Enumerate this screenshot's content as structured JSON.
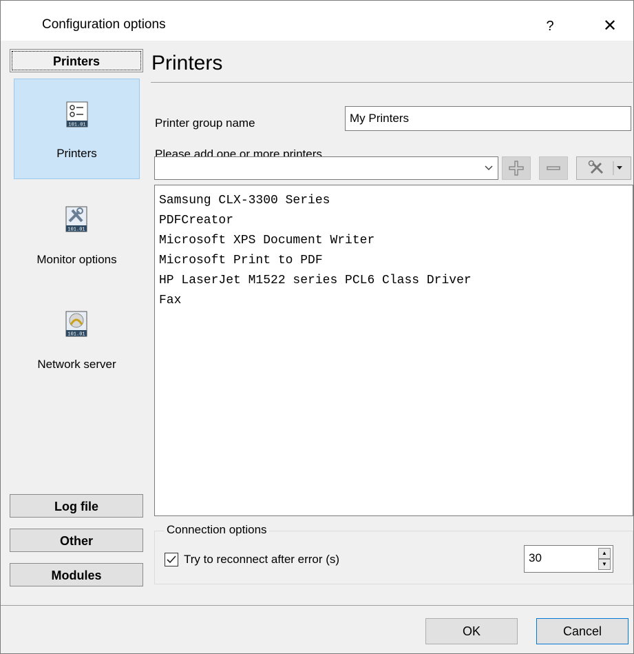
{
  "window": {
    "title": "Configuration options",
    "help": "?",
    "close": "✕"
  },
  "categories": {
    "printers": "Printers",
    "log_file": "Log file",
    "other": "Other",
    "modules": "Modules"
  },
  "sidebar": {
    "items": [
      {
        "label": "Printers",
        "icon": "printers-list-icon",
        "selected": true
      },
      {
        "label": "Monitor options",
        "icon": "tools-icon",
        "selected": false
      },
      {
        "label": "Network server",
        "icon": "network-cable-icon",
        "selected": false
      }
    ]
  },
  "main": {
    "title": "Printers",
    "group_name_label": "Printer group name",
    "group_name_value": "My Printers",
    "add_printers_label": "Please add one or more printers",
    "combo_value": "",
    "printers": [
      "Samsung CLX-3300 Series",
      "PDFCreator",
      "Microsoft XPS Document Writer",
      "Microsoft Print to PDF",
      "HP LaserJet M1522 series PCL6 Class Driver",
      "Fax"
    ]
  },
  "connection": {
    "legend": "Connection options",
    "reconnect_label": "Try to reconnect after error (s)",
    "reconnect_checked": true,
    "reconnect_value": "30"
  },
  "buttons": {
    "ok": "OK",
    "cancel": "Cancel"
  },
  "colors": {
    "selection": "#cce4f7",
    "selection_border": "#99c9ef",
    "accent": "#0078d7"
  }
}
